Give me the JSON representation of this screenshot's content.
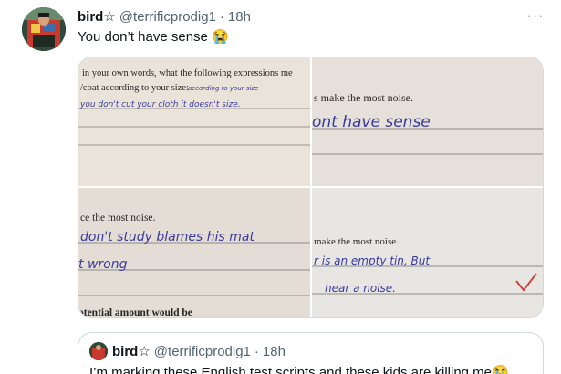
{
  "tweet": {
    "name": "bird",
    "badge": "☆",
    "handle": "@terrificprodig1",
    "separator": "·",
    "time": "18h",
    "text": "You don’t have sense 😭",
    "more_label": "···"
  },
  "media": {
    "images": [
      {
        "printed_top": "in your own words, what the following expressions me",
        "printed_line": "/coat according to your size:",
        "handwriting_above": "according to your size",
        "handwriting": "you don't cut your cloth it doesn't size."
      },
      {
        "printed_line": "s make the most noise.",
        "handwriting": "ont have sense"
      },
      {
        "printed_line": "ce the most noise.",
        "handwriting_1": "don't study blames his mat",
        "handwriting_2": "t wrong",
        "printed_bottom": "otential amount would be"
      },
      {
        "printed_line": "make the most noise.",
        "handwriting_1": "r is   an   empty   tin,  But",
        "handwriting_2": "hear  a  noise."
      }
    ]
  },
  "quoted": {
    "name": "bird",
    "badge": "☆",
    "handle": "@terrificprodig1",
    "separator": "·",
    "time": "18h",
    "text": "I’m marking these English test scripts and these kids are killing me😭"
  }
}
